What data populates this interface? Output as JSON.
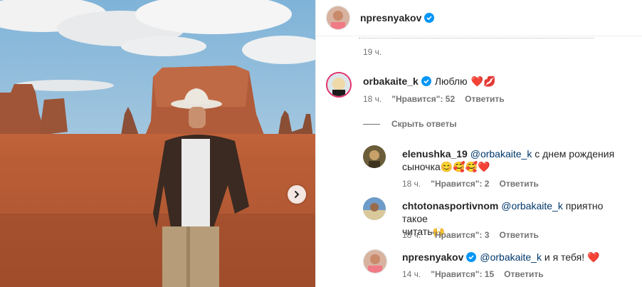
{
  "post": {
    "author": "npresnyakov",
    "next_icon": "chevron-right-icon"
  },
  "top_comment": {
    "time": "19 ч."
  },
  "comment": {
    "user": "orbakaite_k",
    "text": "Люблю",
    "emoji": "❤️💋",
    "time": "18 ч.",
    "likes": "\"Нравится\": 52",
    "reply": "Ответить"
  },
  "hide_replies": "Скрыть ответы",
  "replies": [
    {
      "user": "elenushka_19",
      "mention": "@orbakaite_k",
      "text": " с днем рождения",
      "text2": "сыночка",
      "emoji": "😊🥰🥰❤️",
      "time": "18 ч.",
      "likes": "\"Нравится\": 2",
      "reply": "Ответить"
    },
    {
      "user": "chtotonasportivnom",
      "mention": "@orbakaite_k",
      "text": " приятно такое",
      "text2": "читать",
      "emoji": "🙌",
      "time": "18 ч.",
      "likes": "\"Нравится\": 3",
      "reply": "Ответить"
    },
    {
      "user": "npresnyakov",
      "mention": "@orbakaite_k",
      "text": " и я тебя!",
      "emoji": "❤️",
      "time": "14 ч.",
      "likes": "\"Нравится\": 15",
      "reply": "Ответить"
    }
  ],
  "colors": {
    "verified": "#0095f6",
    "heart": "#ed4956",
    "mention": "#00376b"
  }
}
